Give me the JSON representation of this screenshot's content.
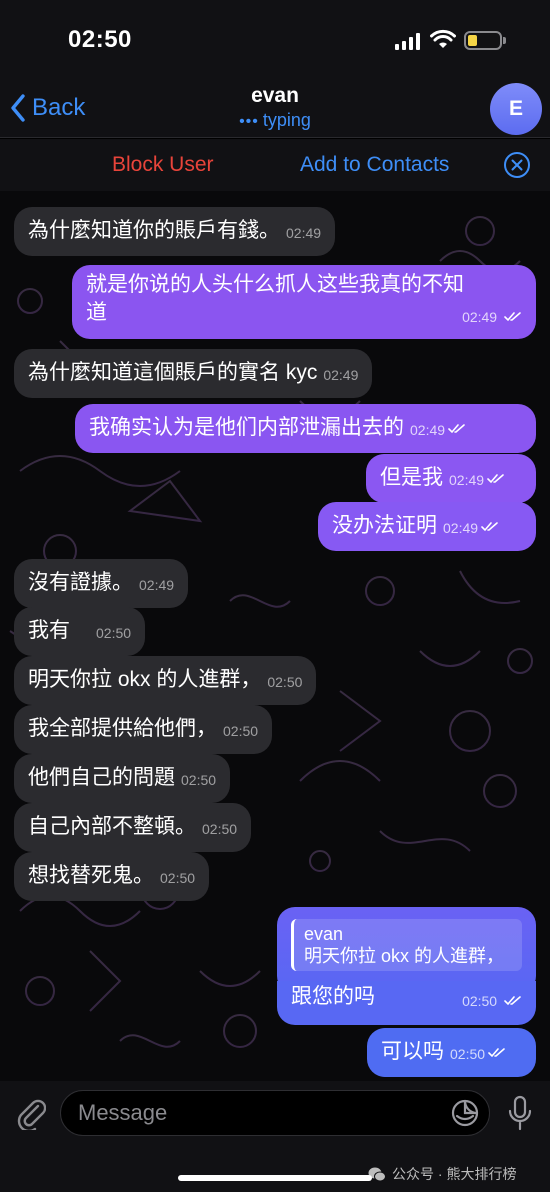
{
  "status_bar": {
    "time": "02:50"
  },
  "nav": {
    "back_label": "Back",
    "title": "evan",
    "status": "typing",
    "avatar_initial": "E",
    "avatar_color": "#6d7af5",
    "accent_color": "#3e8ef7"
  },
  "actions": {
    "block_label": "Block User",
    "add_contacts_label": "Add to Contacts",
    "block_color": "#e8443a"
  },
  "messages": [
    {
      "dir": "in",
      "text": "為什麼知道你的賬戶有錢。",
      "time": "02:49"
    },
    {
      "dir": "out",
      "text_line1": "就是你说的人头什么抓人这些我真的不知",
      "text_line2": "道",
      "time": "02:49"
    },
    {
      "dir": "in",
      "text": "為什麼知道這個賬戶的實名 kyc",
      "time": "02:49"
    },
    {
      "dir": "out",
      "text": "我确实认为是他们内部泄漏出去的",
      "time": "02:49"
    },
    {
      "dir": "out",
      "text": "但是我",
      "time": "02:49"
    },
    {
      "dir": "out",
      "text": "没办法证明",
      "time": "02:49"
    },
    {
      "dir": "in",
      "text": "沒有證據。",
      "time": "02:49"
    },
    {
      "dir": "in",
      "text": "我有",
      "time": "02:50"
    },
    {
      "dir": "in",
      "text": "明天你拉 okx 的人進群，",
      "time": "02:50"
    },
    {
      "dir": "in",
      "text": "我全部提供給他們，",
      "time": "02:50"
    },
    {
      "dir": "in",
      "text": "他們自己的問題",
      "time": "02:50"
    },
    {
      "dir": "in",
      "text": "自己內部不整頓。",
      "time": "02:50"
    },
    {
      "dir": "in",
      "text": "想找替死鬼。",
      "time": "02:50"
    },
    {
      "dir": "out",
      "reply_name": "evan",
      "reply_text": "明天你拉 okx 的人進群，",
      "text": "跟您的吗",
      "time": "02:50"
    },
    {
      "dir": "out",
      "text": "可以吗",
      "time": "02:50"
    }
  ],
  "composer": {
    "placeholder": "Message"
  },
  "watermark": {
    "text": "公众号 · 熊大排行榜"
  }
}
